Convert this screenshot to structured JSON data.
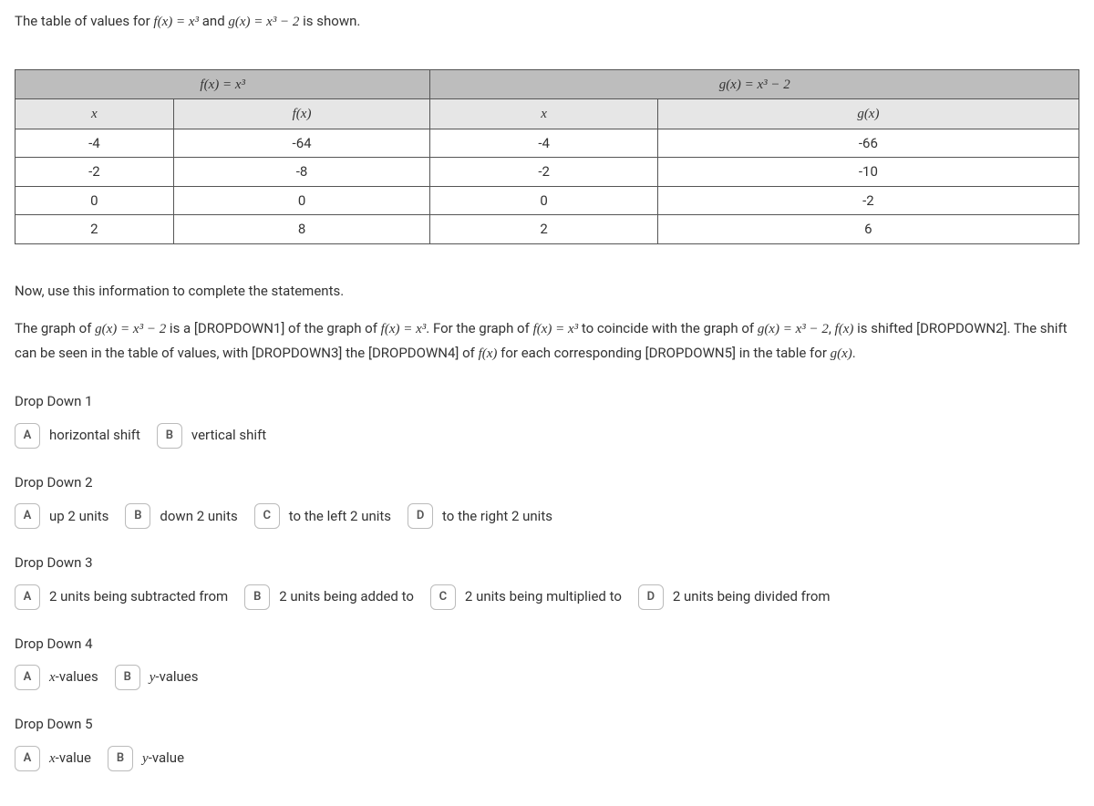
{
  "intro_prefix": "The table of values for ",
  "intro_and": " and ",
  "intro_suffix": " is shown.",
  "f_def_lhs": "f(x)",
  "eq": " = ",
  "x3": "x³",
  "g_def_lhs": "g(x)",
  "x3_minus_2": "x³ − 2",
  "table": {
    "fx_header": "f(x) = x³",
    "gx_header": "g(x) = x³ − 2",
    "x_label": "x",
    "fx_label": "f(x)",
    "gx_label": "g(x)",
    "rows": [
      {
        "x": "-4",
        "fx": "-64",
        "x2": "-4",
        "gx": "-66"
      },
      {
        "x": "-2",
        "fx": "-8",
        "x2": "-2",
        "gx": "-10"
      },
      {
        "x": "0",
        "fx": "0",
        "x2": "0",
        "gx": "-2"
      },
      {
        "x": "2",
        "fx": "8",
        "x2": "2",
        "gx": "6"
      }
    ]
  },
  "instr": "Now, use this information to complete the statements.",
  "para": {
    "p1": "The graph of ",
    "p2": " is a [DROPDOWN1] of the graph of ",
    "p3": ". For the graph of ",
    "p4": " to coincide with the graph of ",
    "p5": ", ",
    "p6": " is shifted [DROPDOWN2]. The shift can be seen in the table of values, with [DROPDOWN3] the [DROPDOWN4] of ",
    "p7": " for each corresponding [DROPDOWN5] in the table for ",
    "p8": ".",
    "gx": "g(x) = x³ − 2",
    "fx": "f(x) = x³",
    "fx_short": "f(x)",
    "gx_short": "g(x)"
  },
  "dropdowns": [
    {
      "title": "Drop Down 1",
      "options": [
        {
          "letter": "A",
          "text": "horizontal shift"
        },
        {
          "letter": "B",
          "text": "vertical shift"
        }
      ]
    },
    {
      "title": "Drop Down 2",
      "options": [
        {
          "letter": "A",
          "text": "up 2 units"
        },
        {
          "letter": "B",
          "text": "down 2 units"
        },
        {
          "letter": "C",
          "text": "to the left 2 units"
        },
        {
          "letter": "D",
          "text": "to the right 2 units"
        }
      ]
    },
    {
      "title": "Drop Down 3",
      "options": [
        {
          "letter": "A",
          "text": "2 units being subtracted from"
        },
        {
          "letter": "B",
          "text": "2 units being added to"
        },
        {
          "letter": "C",
          "text": "2 units being multiplied to"
        },
        {
          "letter": "D",
          "text": "2 units being divided from"
        }
      ]
    },
    {
      "title": "Drop Down 4",
      "options": [
        {
          "letter": "A",
          "text_html": "x-values",
          "italic_first": true
        },
        {
          "letter": "B",
          "text_html": "y-values",
          "italic_first": true
        }
      ]
    },
    {
      "title": "Drop Down 5",
      "options": [
        {
          "letter": "A",
          "text_html": "x-value",
          "italic_first": true
        },
        {
          "letter": "B",
          "text_html": "y-value",
          "italic_first": true
        }
      ]
    }
  ]
}
